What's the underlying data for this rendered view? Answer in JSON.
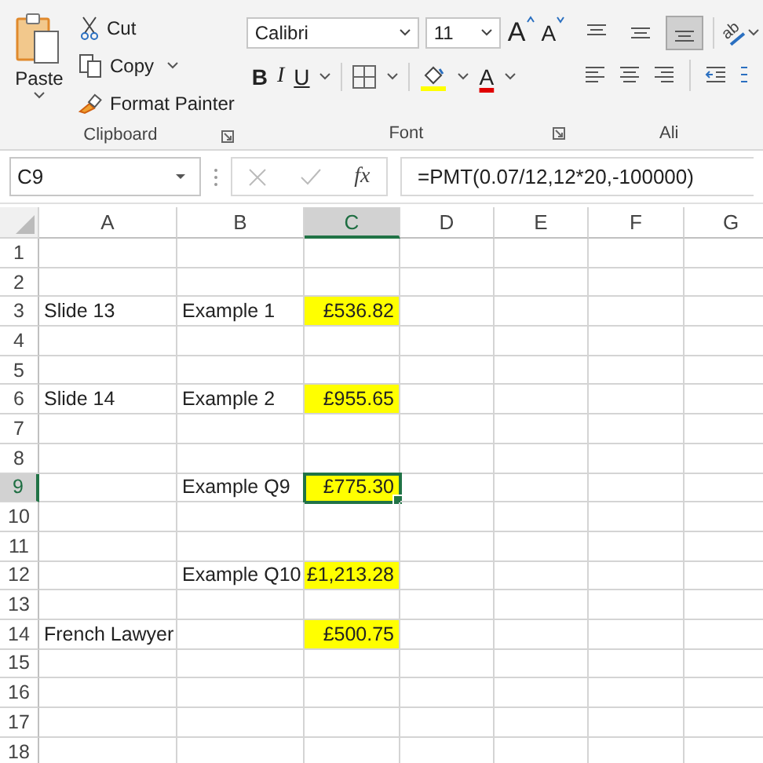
{
  "ribbon": {
    "clipboard": {
      "paste": "Paste",
      "cut": "Cut",
      "copy": "Copy",
      "format_painter": "Format Painter",
      "label": "Clipboard"
    },
    "font": {
      "font_name": "Calibri",
      "font_size": "11",
      "grow": "A",
      "shrink": "A",
      "bold": "B",
      "italic": "I",
      "underline": "U",
      "font_color": "A",
      "label": "Font"
    },
    "alignment": {
      "wrap": "ab",
      "label": "Ali",
      "vertical": [
        {
          "selected": false
        },
        {
          "selected": false
        },
        {
          "selected": true
        }
      ]
    }
  },
  "formula_bar": {
    "name_box": "C9",
    "fx": "fx",
    "formula": "=PMT(0.07/12,12*20,-100000)"
  },
  "columns": [
    {
      "label": "A",
      "selected": false
    },
    {
      "label": "B",
      "selected": false
    },
    {
      "label": "C",
      "selected": true
    },
    {
      "label": "D",
      "selected": false
    },
    {
      "label": "E",
      "selected": false
    },
    {
      "label": "F",
      "selected": false
    },
    {
      "label": "G",
      "selected": false
    }
  ],
  "rows": [
    {
      "number": "1",
      "selected": false,
      "cells": [
        {},
        {},
        {},
        {},
        {},
        {},
        {}
      ]
    },
    {
      "number": "2",
      "selected": false,
      "cells": [
        {},
        {},
        {},
        {},
        {},
        {},
        {}
      ]
    },
    {
      "number": "3",
      "selected": false,
      "cells": [
        {
          "text": "Slide 13"
        },
        {
          "text": "Example 1"
        },
        {
          "text": "£536.82",
          "highlighted": true
        },
        {},
        {},
        {},
        {}
      ]
    },
    {
      "number": "4",
      "selected": false,
      "cells": [
        {},
        {},
        {},
        {},
        {},
        {},
        {}
      ]
    },
    {
      "number": "5",
      "selected": false,
      "cells": [
        {},
        {},
        {},
        {},
        {},
        {},
        {}
      ]
    },
    {
      "number": "6",
      "selected": false,
      "cells": [
        {
          "text": "Slide 14"
        },
        {
          "text": "Example 2"
        },
        {
          "text": "£955.65",
          "highlighted": true
        },
        {},
        {},
        {},
        {}
      ]
    },
    {
      "number": "7",
      "selected": false,
      "cells": [
        {},
        {},
        {},
        {},
        {},
        {},
        {}
      ]
    },
    {
      "number": "8",
      "selected": false,
      "cells": [
        {},
        {},
        {},
        {},
        {},
        {},
        {}
      ]
    },
    {
      "number": "9",
      "selected": true,
      "cells": [
        {},
        {
          "text": "Example Q9"
        },
        {
          "text": "£775.30",
          "highlighted": true,
          "selected": true
        },
        {},
        {},
        {},
        {}
      ]
    },
    {
      "number": "10",
      "selected": false,
      "cells": [
        {},
        {},
        {},
        {},
        {},
        {},
        {}
      ]
    },
    {
      "number": "11",
      "selected": false,
      "cells": [
        {},
        {},
        {},
        {},
        {},
        {},
        {}
      ]
    },
    {
      "number": "12",
      "selected": false,
      "cells": [
        {},
        {
          "text": "Example Q10"
        },
        {
          "text": "£1,213.28",
          "highlighted": true
        },
        {},
        {},
        {},
        {}
      ]
    },
    {
      "number": "13",
      "selected": false,
      "cells": [
        {},
        {},
        {},
        {},
        {},
        {},
        {}
      ]
    },
    {
      "number": "14",
      "selected": false,
      "cells": [
        {
          "text": "French Lawyer"
        },
        {},
        {
          "text": "£500.75",
          "highlighted": true
        },
        {},
        {},
        {},
        {}
      ]
    },
    {
      "number": "15",
      "selected": false,
      "cells": [
        {},
        {},
        {},
        {},
        {},
        {},
        {}
      ]
    },
    {
      "number": "16",
      "selected": false,
      "cells": [
        {},
        {},
        {},
        {},
        {},
        {},
        {}
      ]
    },
    {
      "number": "17",
      "selected": false,
      "cells": [
        {},
        {},
        {},
        {},
        {},
        {},
        {}
      ]
    },
    {
      "number": "18",
      "selected": false,
      "cells": [
        {},
        {},
        {},
        {},
        {},
        {},
        {}
      ]
    }
  ]
}
